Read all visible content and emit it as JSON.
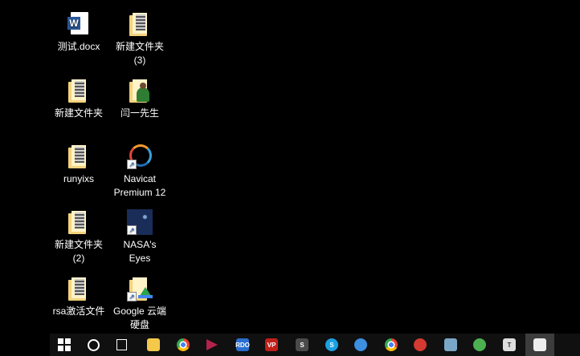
{
  "desktop_icons": [
    {
      "name": "word-doc",
      "icon": "word-icon",
      "lines": [
        "测试.docx",
        ""
      ]
    },
    {
      "name": "folder-3",
      "icon": "folder-icon",
      "lines": [
        "新建文件夹",
        "(3)"
      ]
    },
    {
      "name": "folder-1",
      "icon": "folder-icon",
      "lines": [
        "新建文件夹",
        ""
      ]
    },
    {
      "name": "user-folder",
      "icon": "user-folder-icon",
      "lines": [
        "闫一先生",
        ""
      ]
    },
    {
      "name": "runyixs",
      "icon": "folder-icon",
      "lines": [
        "runyixs",
        ""
      ]
    },
    {
      "name": "navicat",
      "icon": "navicat-icon",
      "lines": [
        "Navicat",
        "Premium 12"
      ]
    },
    {
      "name": "folder-2",
      "icon": "folder-icon",
      "lines": [
        "新建文件夹",
        "(2)"
      ]
    },
    {
      "name": "nasa-eyes",
      "icon": "nasa-eyes-icon",
      "lines": [
        "NASA's",
        "Eyes"
      ]
    },
    {
      "name": "rsa-file",
      "icon": "folder-icon",
      "lines": [
        "rsa激活文件",
        ""
      ]
    },
    {
      "name": "google-drive",
      "icon": "google-drive-icon",
      "lines": [
        "Google 云端",
        "硬盘"
      ]
    }
  ],
  "taskbar": [
    {
      "name": "start",
      "icon": "windows-icon",
      "color": "#ffffff"
    },
    {
      "name": "cortana",
      "icon": "circle-icon",
      "color": "#ffffff"
    },
    {
      "name": "task-view",
      "icon": "task-view-icon",
      "color": "#ffffff"
    },
    {
      "name": "file-explorer",
      "icon": "folder-icon",
      "color": "#f3c84b"
    },
    {
      "name": "chrome",
      "icon": "chrome-icon",
      "color": "#e84335"
    },
    {
      "name": "paper-plane-app",
      "icon": "paper-plane-icon",
      "color": "#b3224a"
    },
    {
      "name": "rdo",
      "icon": "rdo-icon",
      "color": "#2a6ecf",
      "text": "RDO"
    },
    {
      "name": "vpn-app",
      "icon": "vpn-icon",
      "color": "#c0201a",
      "text": "VP"
    },
    {
      "name": "sublime",
      "icon": "sublime-icon",
      "color": "#4a4a4a",
      "text": "S"
    },
    {
      "name": "skype",
      "icon": "skype-icon",
      "color": "#1ba1e2",
      "text": "S"
    },
    {
      "name": "feishu-app",
      "icon": "bird-icon",
      "color": "#3d8fe0"
    },
    {
      "name": "chrome-2",
      "icon": "chrome-icon",
      "color": "#e84335"
    },
    {
      "name": "netease-music",
      "icon": "music-icon",
      "color": "#d33a31"
    },
    {
      "name": "monitor-app",
      "icon": "monitor-icon",
      "color": "#7aa7c7"
    },
    {
      "name": "wechat",
      "icon": "wechat-icon",
      "color": "#4caf50"
    },
    {
      "name": "typora",
      "icon": "typora-icon",
      "color": "#dddddd",
      "text": "T"
    },
    {
      "name": "remote-desktop",
      "icon": "display-icon",
      "color": "#eeeeee",
      "active": true
    }
  ]
}
